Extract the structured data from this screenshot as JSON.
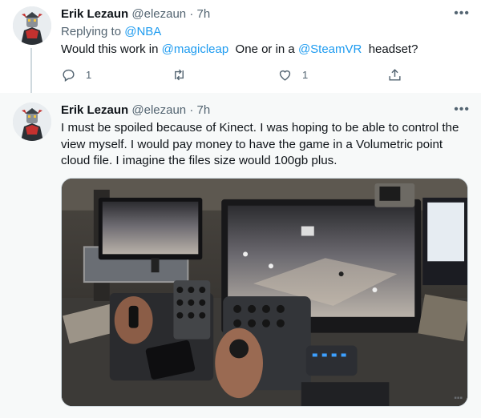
{
  "colors": {
    "link": "#1d9bf0",
    "muted": "#536471",
    "text": "#0f1419"
  },
  "tweets": [
    {
      "author": "Erik Lezaun",
      "handle": "@elezaun",
      "sep": "·",
      "time": "7h",
      "replying_label": "Replying to",
      "replying_to": "@NBA",
      "text_parts": [
        "Would this work in ",
        "@magicleap",
        "  One or in a ",
        "@SteamVR",
        "  headset?"
      ],
      "reply_count": "1",
      "like_count": "1",
      "icons": [
        "reply-icon",
        "retweet-icon",
        "like-icon",
        "share-icon"
      ]
    },
    {
      "author": "Erik Lezaun",
      "handle": "@elezaun",
      "sep": "·",
      "time": "7h",
      "text": "I must be spoiled because of Kinect. I was hoping to be able to control the view myself. I would pay money to have the game in a Volumetric point cloud file. I imagine the files size would 100gb plus."
    }
  ]
}
